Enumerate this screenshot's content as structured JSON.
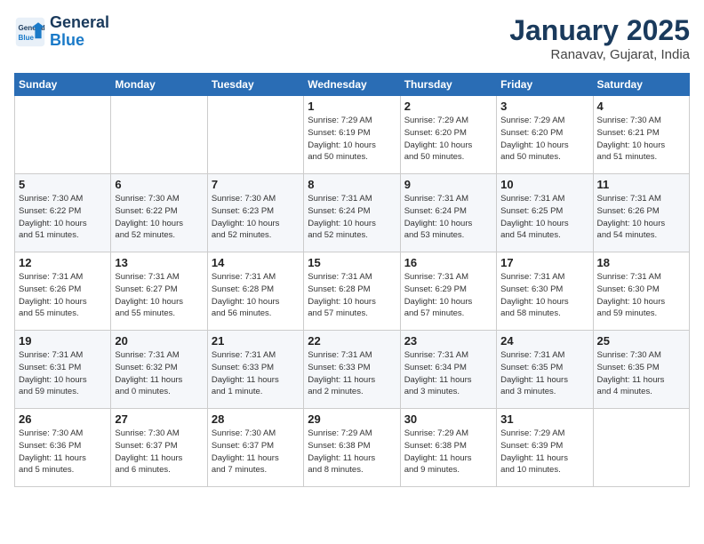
{
  "header": {
    "logo_line1": "General",
    "logo_line2": "Blue",
    "month": "January 2025",
    "location": "Ranavav, Gujarat, India"
  },
  "weekdays": [
    "Sunday",
    "Monday",
    "Tuesday",
    "Wednesday",
    "Thursday",
    "Friday",
    "Saturday"
  ],
  "weeks": [
    [
      {
        "day": "",
        "info": ""
      },
      {
        "day": "",
        "info": ""
      },
      {
        "day": "",
        "info": ""
      },
      {
        "day": "1",
        "info": "Sunrise: 7:29 AM\nSunset: 6:19 PM\nDaylight: 10 hours\nand 50 minutes."
      },
      {
        "day": "2",
        "info": "Sunrise: 7:29 AM\nSunset: 6:20 PM\nDaylight: 10 hours\nand 50 minutes."
      },
      {
        "day": "3",
        "info": "Sunrise: 7:29 AM\nSunset: 6:20 PM\nDaylight: 10 hours\nand 50 minutes."
      },
      {
        "day": "4",
        "info": "Sunrise: 7:30 AM\nSunset: 6:21 PM\nDaylight: 10 hours\nand 51 minutes."
      }
    ],
    [
      {
        "day": "5",
        "info": "Sunrise: 7:30 AM\nSunset: 6:22 PM\nDaylight: 10 hours\nand 51 minutes."
      },
      {
        "day": "6",
        "info": "Sunrise: 7:30 AM\nSunset: 6:22 PM\nDaylight: 10 hours\nand 52 minutes."
      },
      {
        "day": "7",
        "info": "Sunrise: 7:30 AM\nSunset: 6:23 PM\nDaylight: 10 hours\nand 52 minutes."
      },
      {
        "day": "8",
        "info": "Sunrise: 7:31 AM\nSunset: 6:24 PM\nDaylight: 10 hours\nand 52 minutes."
      },
      {
        "day": "9",
        "info": "Sunrise: 7:31 AM\nSunset: 6:24 PM\nDaylight: 10 hours\nand 53 minutes."
      },
      {
        "day": "10",
        "info": "Sunrise: 7:31 AM\nSunset: 6:25 PM\nDaylight: 10 hours\nand 54 minutes."
      },
      {
        "day": "11",
        "info": "Sunrise: 7:31 AM\nSunset: 6:26 PM\nDaylight: 10 hours\nand 54 minutes."
      }
    ],
    [
      {
        "day": "12",
        "info": "Sunrise: 7:31 AM\nSunset: 6:26 PM\nDaylight: 10 hours\nand 55 minutes."
      },
      {
        "day": "13",
        "info": "Sunrise: 7:31 AM\nSunset: 6:27 PM\nDaylight: 10 hours\nand 55 minutes."
      },
      {
        "day": "14",
        "info": "Sunrise: 7:31 AM\nSunset: 6:28 PM\nDaylight: 10 hours\nand 56 minutes."
      },
      {
        "day": "15",
        "info": "Sunrise: 7:31 AM\nSunset: 6:28 PM\nDaylight: 10 hours\nand 57 minutes."
      },
      {
        "day": "16",
        "info": "Sunrise: 7:31 AM\nSunset: 6:29 PM\nDaylight: 10 hours\nand 57 minutes."
      },
      {
        "day": "17",
        "info": "Sunrise: 7:31 AM\nSunset: 6:30 PM\nDaylight: 10 hours\nand 58 minutes."
      },
      {
        "day": "18",
        "info": "Sunrise: 7:31 AM\nSunset: 6:30 PM\nDaylight: 10 hours\nand 59 minutes."
      }
    ],
    [
      {
        "day": "19",
        "info": "Sunrise: 7:31 AM\nSunset: 6:31 PM\nDaylight: 10 hours\nand 59 minutes."
      },
      {
        "day": "20",
        "info": "Sunrise: 7:31 AM\nSunset: 6:32 PM\nDaylight: 11 hours\nand 0 minutes."
      },
      {
        "day": "21",
        "info": "Sunrise: 7:31 AM\nSunset: 6:33 PM\nDaylight: 11 hours\nand 1 minute."
      },
      {
        "day": "22",
        "info": "Sunrise: 7:31 AM\nSunset: 6:33 PM\nDaylight: 11 hours\nand 2 minutes."
      },
      {
        "day": "23",
        "info": "Sunrise: 7:31 AM\nSunset: 6:34 PM\nDaylight: 11 hours\nand 3 minutes."
      },
      {
        "day": "24",
        "info": "Sunrise: 7:31 AM\nSunset: 6:35 PM\nDaylight: 11 hours\nand 3 minutes."
      },
      {
        "day": "25",
        "info": "Sunrise: 7:30 AM\nSunset: 6:35 PM\nDaylight: 11 hours\nand 4 minutes."
      }
    ],
    [
      {
        "day": "26",
        "info": "Sunrise: 7:30 AM\nSunset: 6:36 PM\nDaylight: 11 hours\nand 5 minutes."
      },
      {
        "day": "27",
        "info": "Sunrise: 7:30 AM\nSunset: 6:37 PM\nDaylight: 11 hours\nand 6 minutes."
      },
      {
        "day": "28",
        "info": "Sunrise: 7:30 AM\nSunset: 6:37 PM\nDaylight: 11 hours\nand 7 minutes."
      },
      {
        "day": "29",
        "info": "Sunrise: 7:29 AM\nSunset: 6:38 PM\nDaylight: 11 hours\nand 8 minutes."
      },
      {
        "day": "30",
        "info": "Sunrise: 7:29 AM\nSunset: 6:38 PM\nDaylight: 11 hours\nand 9 minutes."
      },
      {
        "day": "31",
        "info": "Sunrise: 7:29 AM\nSunset: 6:39 PM\nDaylight: 11 hours\nand 10 minutes."
      },
      {
        "day": "",
        "info": ""
      }
    ]
  ]
}
